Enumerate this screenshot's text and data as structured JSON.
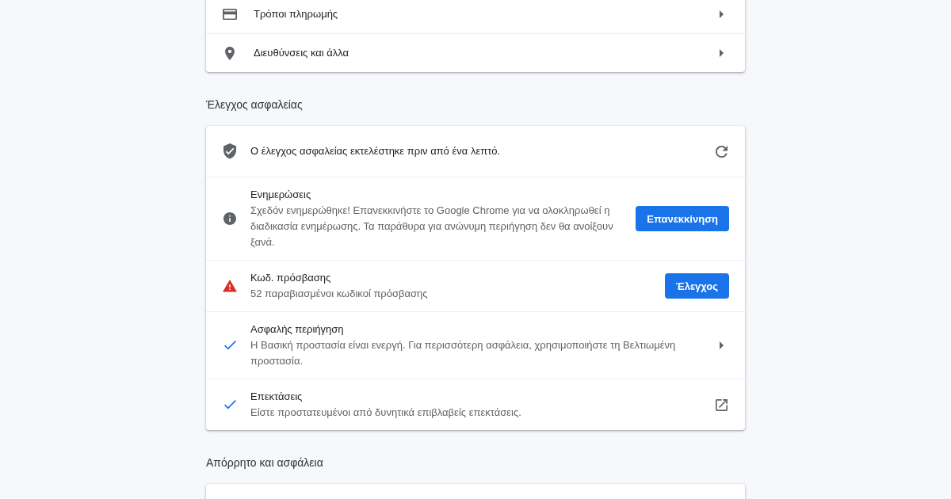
{
  "autofill": {
    "items": [
      {
        "kind": "payment",
        "label": "Τρόποι πληρωμής"
      },
      {
        "kind": "address",
        "label": "Διευθύνσεις και άλλα"
      }
    ]
  },
  "safety_check": {
    "heading": "Έλεγχος ασφαλείας",
    "rows": [
      {
        "kind": "summary",
        "text": "Ο έλεγχος ασφαλείας εκτελέστηκε πριν από ένα λεπτό.",
        "trailing": {
          "kind": "refresh"
        }
      },
      {
        "kind": "info",
        "title": "Ενημερώσεις",
        "description": "Σχεδόν ενημερώθηκε! Επανεκκινήστε το Google Chrome για να ολοκληρωθεί η διαδικασία ενημέρωσης. Τα παράθυρα για ανώνυμη περιήγηση δεν θα ανοίξουν ξανά.",
        "trailing": {
          "kind": "button",
          "label": "Επανεκκίνηση"
        }
      },
      {
        "kind": "warning",
        "title": "Κωδ. πρόσβασης",
        "description": "52 παραβιασμένοι κωδικοί πρόσβασης",
        "trailing": {
          "kind": "button",
          "label": "Έλεγχος"
        }
      },
      {
        "kind": "safe",
        "title": "Ασφαλής περιήγηση",
        "description": "Η Βασική προστασία είναι ενεργή. Για περισσότερη ασφάλεια, χρησιμοποιήστε τη Βελτιωμένη προστασία.",
        "trailing": {
          "kind": "chevron"
        }
      },
      {
        "kind": "safe",
        "title": "Επεκτάσεις",
        "description": "Είστε προστατευμένοι από δυνητικά επιβλαβείς επεκτάσεις.",
        "trailing": {
          "kind": "external"
        }
      }
    ]
  },
  "privacy": {
    "heading": "Απόρρητο και ασφάλεια"
  }
}
